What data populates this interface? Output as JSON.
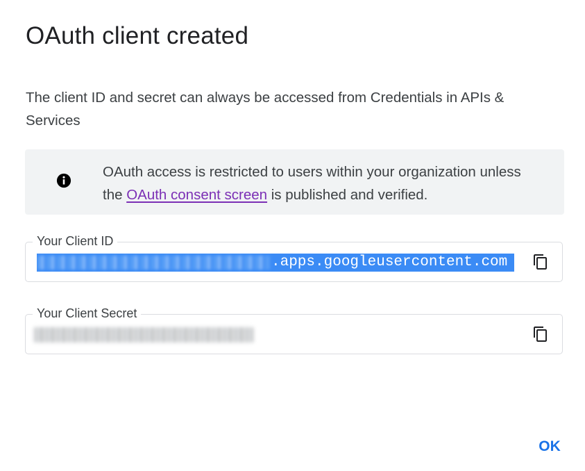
{
  "dialog": {
    "title": "OAuth client created",
    "description": "The client ID and secret can always be accessed from Credentials in APIs & Services",
    "info": {
      "icon": "info-icon",
      "text_before": "OAuth access is restricted to users within your organization unless the ",
      "link_text": "OAuth consent screen",
      "text_after": " is published and verified."
    },
    "client_id": {
      "label": "Your Client ID",
      "value_visible": ".apps.googleusercontent.com",
      "copy_icon": "copy-icon"
    },
    "client_secret": {
      "label": "Your Client Secret",
      "copy_icon": "copy-icon"
    },
    "ok_label": "OK"
  },
  "colors": {
    "link": "#7b2fb5",
    "selection": "#3b8bf5",
    "primary": "#1a73e8",
    "info_bg": "#f1f3f4"
  }
}
